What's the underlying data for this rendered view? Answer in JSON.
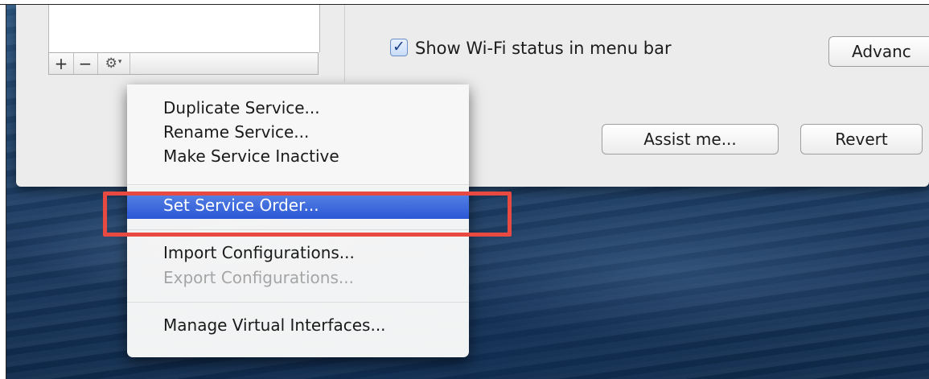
{
  "service_bar": {
    "add": "+",
    "remove": "−",
    "gear": "⚙",
    "gear_caret": "▾",
    "gear_icon": "gear-icon"
  },
  "wifi": {
    "checkbox_mark": "✓",
    "checked": true,
    "label": "Show Wi-Fi status in menu bar"
  },
  "buttons": {
    "advanced": "Advanc",
    "assist": "Assist me...",
    "revert": "Revert"
  },
  "menu": {
    "items": [
      {
        "label": "Duplicate Service...",
        "enabled": true
      },
      {
        "label": "Rename Service...",
        "enabled": true
      },
      {
        "label": "Make Service Inactive",
        "enabled": true
      },
      {
        "label": "Set Service Order...",
        "enabled": true,
        "selected": true
      },
      {
        "label": "Import Configurations...",
        "enabled": true
      },
      {
        "label": "Export Configurations...",
        "enabled": false
      },
      {
        "label": "Manage Virtual Interfaces...",
        "enabled": true
      }
    ]
  },
  "colors": {
    "menu_selection": "#2a57d6",
    "highlight_box": "#e84a41",
    "checkbox": "#1a3f8a"
  }
}
